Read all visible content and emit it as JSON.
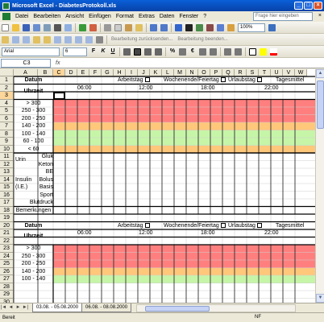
{
  "window": {
    "title": "Microsoft Excel - DiabetesProtokoll.xls",
    "btn_min": "_",
    "btn_max": "□",
    "btn_close": "×"
  },
  "menu": {
    "items": [
      "Datei",
      "Bearbeiten",
      "Ansicht",
      "Einfügen",
      "Format",
      "Extras",
      "Daten",
      "Fenster",
      "?"
    ],
    "ask_placeholder": "Frage hier eingeben",
    "close": "×"
  },
  "toolbar": {
    "zoom": "100%",
    "review_reply": "Bearbeitung zurücksenden...",
    "review_end": "Bearbeitung beenden...",
    "font_name": "Arial",
    "font_size": "6",
    "bold": "F",
    "italic": "K",
    "underline": "U",
    "currency": "€",
    "percent": "%"
  },
  "formula_bar": {
    "name_box": "C3",
    "fx": "fx",
    "content": ""
  },
  "columns": [
    "A",
    "B",
    "C",
    "D",
    "E",
    "F",
    "G",
    "H",
    "I",
    "J",
    "K",
    "L",
    "M",
    "N",
    "O",
    "P",
    "Q",
    "R",
    "S",
    "T",
    "U",
    "V",
    "W"
  ],
  "selected_column": "C",
  "rows": [
    "1",
    "2",
    "3",
    "4",
    "5",
    "6",
    "7",
    "8",
    "9",
    "10",
    "11",
    "12",
    "13",
    "14",
    "15",
    "16",
    "17",
    "18",
    "19",
    "20",
    "21",
    "22",
    "23",
    "24",
    "25",
    "26",
    "27",
    "28",
    "29",
    "30"
  ],
  "selected_row": "3",
  "sheet": {
    "datum": "Datum",
    "uhrzeit": "Uhrzeit",
    "arbeitstag": "Arbeitstag",
    "wochenende": "Wochenende/Feiertag",
    "urlaubstag": "Urlaubstag",
    "tagesmittel": "Tagesmittel",
    "times": [
      "06:00",
      "12:00",
      "18:00",
      "22:00"
    ],
    "ranges": [
      "> 300",
      "250 - 300",
      "200 - 250",
      "140 - 200",
      "100 - 140",
      "60 - 100",
      "< 60"
    ],
    "urin": "Urin",
    "gluk": "Gluk",
    "keton": "Keton",
    "be": "BE",
    "insulin": "Insulin",
    "ie": "(I.E.)",
    "bolus": "Bolus",
    "basis": "Basis",
    "sport": "Sport",
    "blutdruck": "Blutdruck",
    "bemerkungen": "Bemerkungen",
    "ranges2": [
      "> 300",
      "250 - 300",
      "200 - 250",
      "140 - 200",
      "100 - 140"
    ]
  },
  "colors": {
    "red": "#ff7f7f",
    "orange": "#ffc77a",
    "green": "#c6f5a8",
    "selection": "#fcd69b"
  },
  "sheet_tabs": [
    "03.08. - 05.08.2000",
    "06.08. - 08.08.2000"
  ],
  "active_tab": 0,
  "nav": [
    "|◄",
    "◄",
    "►",
    "►|"
  ],
  "status": {
    "left": "Bereit",
    "right": "NF"
  }
}
